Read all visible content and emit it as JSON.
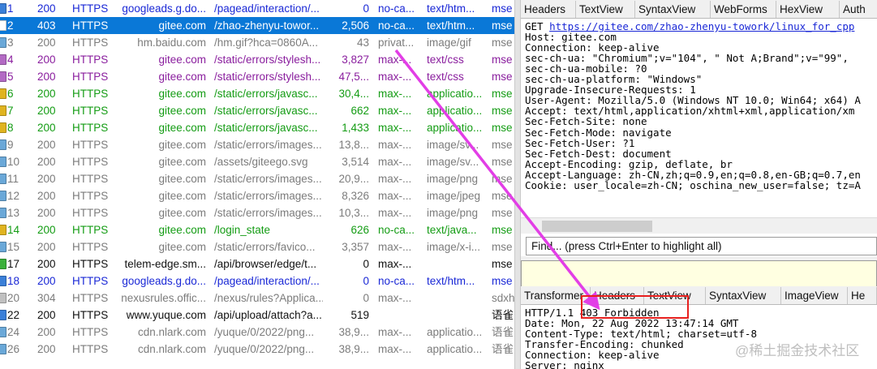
{
  "session_list": [
    {
      "num": "1",
      "result": "200",
      "protocol": "HTTPS",
      "host": "googleads.g.do...",
      "url": "/pagead/interaction/...",
      "body": "0",
      "caching": "no-ca...",
      "content_type": "text/htm...",
      "process": "mse",
      "color": "blue",
      "icon": "js-doc-icon",
      "icon_color": "#3a7fd8"
    },
    {
      "num": "2",
      "result": "403",
      "protocol": "HTTPS",
      "host": "gitee.com",
      "url": "/zhao-zhenyu-towor...",
      "body": "2,506",
      "caching": "no-ca...",
      "content_type": "text/htm...",
      "process": "mse",
      "color": "black",
      "icon": "html-doc-icon",
      "icon_color": "#ffffff",
      "selected": true
    },
    {
      "num": "3",
      "result": "200",
      "protocol": "HTTPS",
      "host": "hm.baidu.com",
      "url": "/hm.gif?hca=0860A...",
      "body": "43",
      "caching": "privat...",
      "content_type": "image/gif",
      "process": "mse",
      "color": "gray",
      "icon": "image-icon",
      "icon_color": "#6aa8d8"
    },
    {
      "num": "4",
      "result": "200",
      "protocol": "HTTPS",
      "host": "gitee.com",
      "url": "/static/errors/stylesh...",
      "body": "3,827",
      "caching": "max-...",
      "content_type": "text/css",
      "process": "mse",
      "color": "purple",
      "icon": "css-icon",
      "icon_color": "#b36ac4"
    },
    {
      "num": "5",
      "result": "200",
      "protocol": "HTTPS",
      "host": "gitee.com",
      "url": "/static/errors/stylesh...",
      "body": "47,5...",
      "caching": "max-...",
      "content_type": "text/css",
      "process": "mse",
      "color": "purple",
      "icon": "css-icon",
      "icon_color": "#b36ac4"
    },
    {
      "num": "6",
      "result": "200",
      "protocol": "HTTPS",
      "host": "gitee.com",
      "url": "/static/errors/javasc...",
      "body": "30,4...",
      "caching": "max-...",
      "content_type": "applicatio...",
      "process": "mse",
      "color": "green",
      "icon": "script-icon",
      "icon_color": "#e0b420"
    },
    {
      "num": "7",
      "result": "200",
      "protocol": "HTTPS",
      "host": "gitee.com",
      "url": "/static/errors/javasc...",
      "body": "662",
      "caching": "max-...",
      "content_type": "applicatio...",
      "process": "mse",
      "color": "green",
      "icon": "script-icon",
      "icon_color": "#e0b420"
    },
    {
      "num": "8",
      "result": "200",
      "protocol": "HTTPS",
      "host": "gitee.com",
      "url": "/static/errors/javasc...",
      "body": "1,433",
      "caching": "max-...",
      "content_type": "applicatio...",
      "process": "mse",
      "color": "green",
      "icon": "script-icon",
      "icon_color": "#e0b420"
    },
    {
      "num": "9",
      "result": "200",
      "protocol": "HTTPS",
      "host": "gitee.com",
      "url": "/static/errors/images...",
      "body": "13,8...",
      "caching": "max-...",
      "content_type": "image/sv...",
      "process": "mse",
      "color": "gray",
      "icon": "image-icon",
      "icon_color": "#6aa8d8"
    },
    {
      "num": "10",
      "result": "200",
      "protocol": "HTTPS",
      "host": "gitee.com",
      "url": "/assets/giteego.svg",
      "body": "3,514",
      "caching": "max-...",
      "content_type": "image/sv...",
      "process": "mse",
      "color": "gray",
      "icon": "image-icon",
      "icon_color": "#6aa8d8"
    },
    {
      "num": "11",
      "result": "200",
      "protocol": "HTTPS",
      "host": "gitee.com",
      "url": "/static/errors/images...",
      "body": "20,9...",
      "caching": "max-...",
      "content_type": "image/png",
      "process": "mse",
      "color": "gray",
      "icon": "image-icon",
      "icon_color": "#6aa8d8"
    },
    {
      "num": "12",
      "result": "200",
      "protocol": "HTTPS",
      "host": "gitee.com",
      "url": "/static/errors/images...",
      "body": "8,326",
      "caching": "max-...",
      "content_type": "image/jpeg",
      "process": "mse",
      "color": "gray",
      "icon": "image-icon",
      "icon_color": "#6aa8d8"
    },
    {
      "num": "13",
      "result": "200",
      "protocol": "HTTPS",
      "host": "gitee.com",
      "url": "/static/errors/images...",
      "body": "10,3...",
      "caching": "max-...",
      "content_type": "image/png",
      "process": "mse",
      "color": "gray",
      "icon": "image-icon",
      "icon_color": "#6aa8d8"
    },
    {
      "num": "14",
      "result": "200",
      "protocol": "HTTPS",
      "host": "gitee.com",
      "url": "/login_state",
      "body": "626",
      "caching": "no-ca...",
      "content_type": "text/java...",
      "process": "mse",
      "color": "green",
      "icon": "script-icon",
      "icon_color": "#e0b420"
    },
    {
      "num": "15",
      "result": "200",
      "protocol": "HTTPS",
      "host": "gitee.com",
      "url": "/static/errors/favico...",
      "body": "3,357",
      "caching": "max-...",
      "content_type": "image/x-i...",
      "process": "mse",
      "color": "gray",
      "icon": "image-icon",
      "icon_color": "#6aa8d8"
    },
    {
      "num": "17",
      "result": "200",
      "protocol": "HTTPS",
      "host": "telem-edge.sm...",
      "url": "/api/browser/edge/t...",
      "body": "0",
      "caching": "max-...",
      "content_type": "",
      "process": "mse",
      "color": "black",
      "icon": "upload-arrow-icon",
      "icon_color": "#3bb03b"
    },
    {
      "num": "18",
      "result": "200",
      "protocol": "HTTPS",
      "host": "googleads.g.do...",
      "url": "/pagead/interaction/...",
      "body": "0",
      "caching": "no-ca...",
      "content_type": "text/htm...",
      "process": "mse",
      "color": "blue",
      "icon": "js-doc-icon",
      "icon_color": "#3a7fd8"
    },
    {
      "num": "20",
      "result": "304",
      "protocol": "HTTPS",
      "host": "nexusrules.offic...",
      "url": "/nexus/rules?Applica...",
      "body": "0",
      "caching": "max-...",
      "content_type": "",
      "process": "sdxh",
      "color": "gray",
      "icon": "not-modified-icon",
      "icon_color": "#c0c0c0"
    },
    {
      "num": "22",
      "result": "200",
      "protocol": "HTTPS",
      "host": "www.yuque.com",
      "url": "/api/upload/attach?a...",
      "body": "519",
      "caching": "",
      "content_type": "",
      "process": "语雀",
      "color": "black",
      "icon": "document-icon",
      "icon_color": "#3a7fd8"
    },
    {
      "num": "24",
      "result": "200",
      "protocol": "HTTPS",
      "host": "cdn.nlark.com",
      "url": "/yuque/0/2022/png...",
      "body": "38,9...",
      "caching": "max-...",
      "content_type": "applicatio...",
      "process": "语雀",
      "color": "gray",
      "icon": "image-icon",
      "icon_color": "#6aa8d8"
    },
    {
      "num": "26",
      "result": "200",
      "protocol": "HTTPS",
      "host": "cdn.nlark.com",
      "url": "/yuque/0/2022/png...",
      "body": "38,9...",
      "caching": "max-...",
      "content_type": "applicatio...",
      "process": "语雀",
      "color": "gray",
      "icon": "image-icon",
      "icon_color": "#6aa8d8"
    }
  ],
  "request_tabs": [
    "Headers",
    "TextView",
    "SyntaxView",
    "WebForms",
    "HexView",
    "Auth"
  ],
  "request": {
    "method": "GET",
    "url": "https://gitee.com/zhao-zhenyu-towork/linux_for_cpp",
    "lines": [
      "Host: gitee.com",
      "Connection: keep-alive",
      "sec-ch-ua: \"Chromium\";v=\"104\", \" Not A;Brand\";v=\"99\", ",
      "sec-ch-ua-mobile: ?0",
      "sec-ch-ua-platform: \"Windows\"",
      "Upgrade-Insecure-Requests: 1",
      "User-Agent: Mozilla/5.0 (Windows NT 10.0; Win64; x64) A",
      "Accept: text/html,application/xhtml+xml,application/xm",
      "Sec-Fetch-Site: none",
      "Sec-Fetch-Mode: navigate",
      "Sec-Fetch-User: ?1",
      "Sec-Fetch-Dest: document",
      "Accept-Encoding: gzip, deflate, br",
      "Accept-Language: zh-CN,zh;q=0.9,en;q=0.8,en-GB;q=0.7,en",
      "Cookie: user_locale=zh-CN; oschina_new_user=false; tz=A"
    ]
  },
  "find_placeholder": "Find... (press Ctrl+Enter to highlight all)",
  "response_tabs": [
    "Transformer",
    "Headers",
    "TextView",
    "SyntaxView",
    "ImageView",
    "He"
  ],
  "response": {
    "status_prefix": "HTTP/1.1 ",
    "status_code": "403 Forbidden",
    "lines": [
      "Date: Mon, 22 Aug 2022 13:47:14 GMT",
      "Content-Type: text/html; charset=utf-8",
      "Transfer-Encoding: chunked",
      "Connection: keep-alive",
      "Server: nginx"
    ]
  },
  "watermark": "@稀土掘金技术社区",
  "colors": {
    "selection": "#0a78d7",
    "annotation_arrow": "#e23ee6",
    "highlight_box": "#e8201e"
  }
}
